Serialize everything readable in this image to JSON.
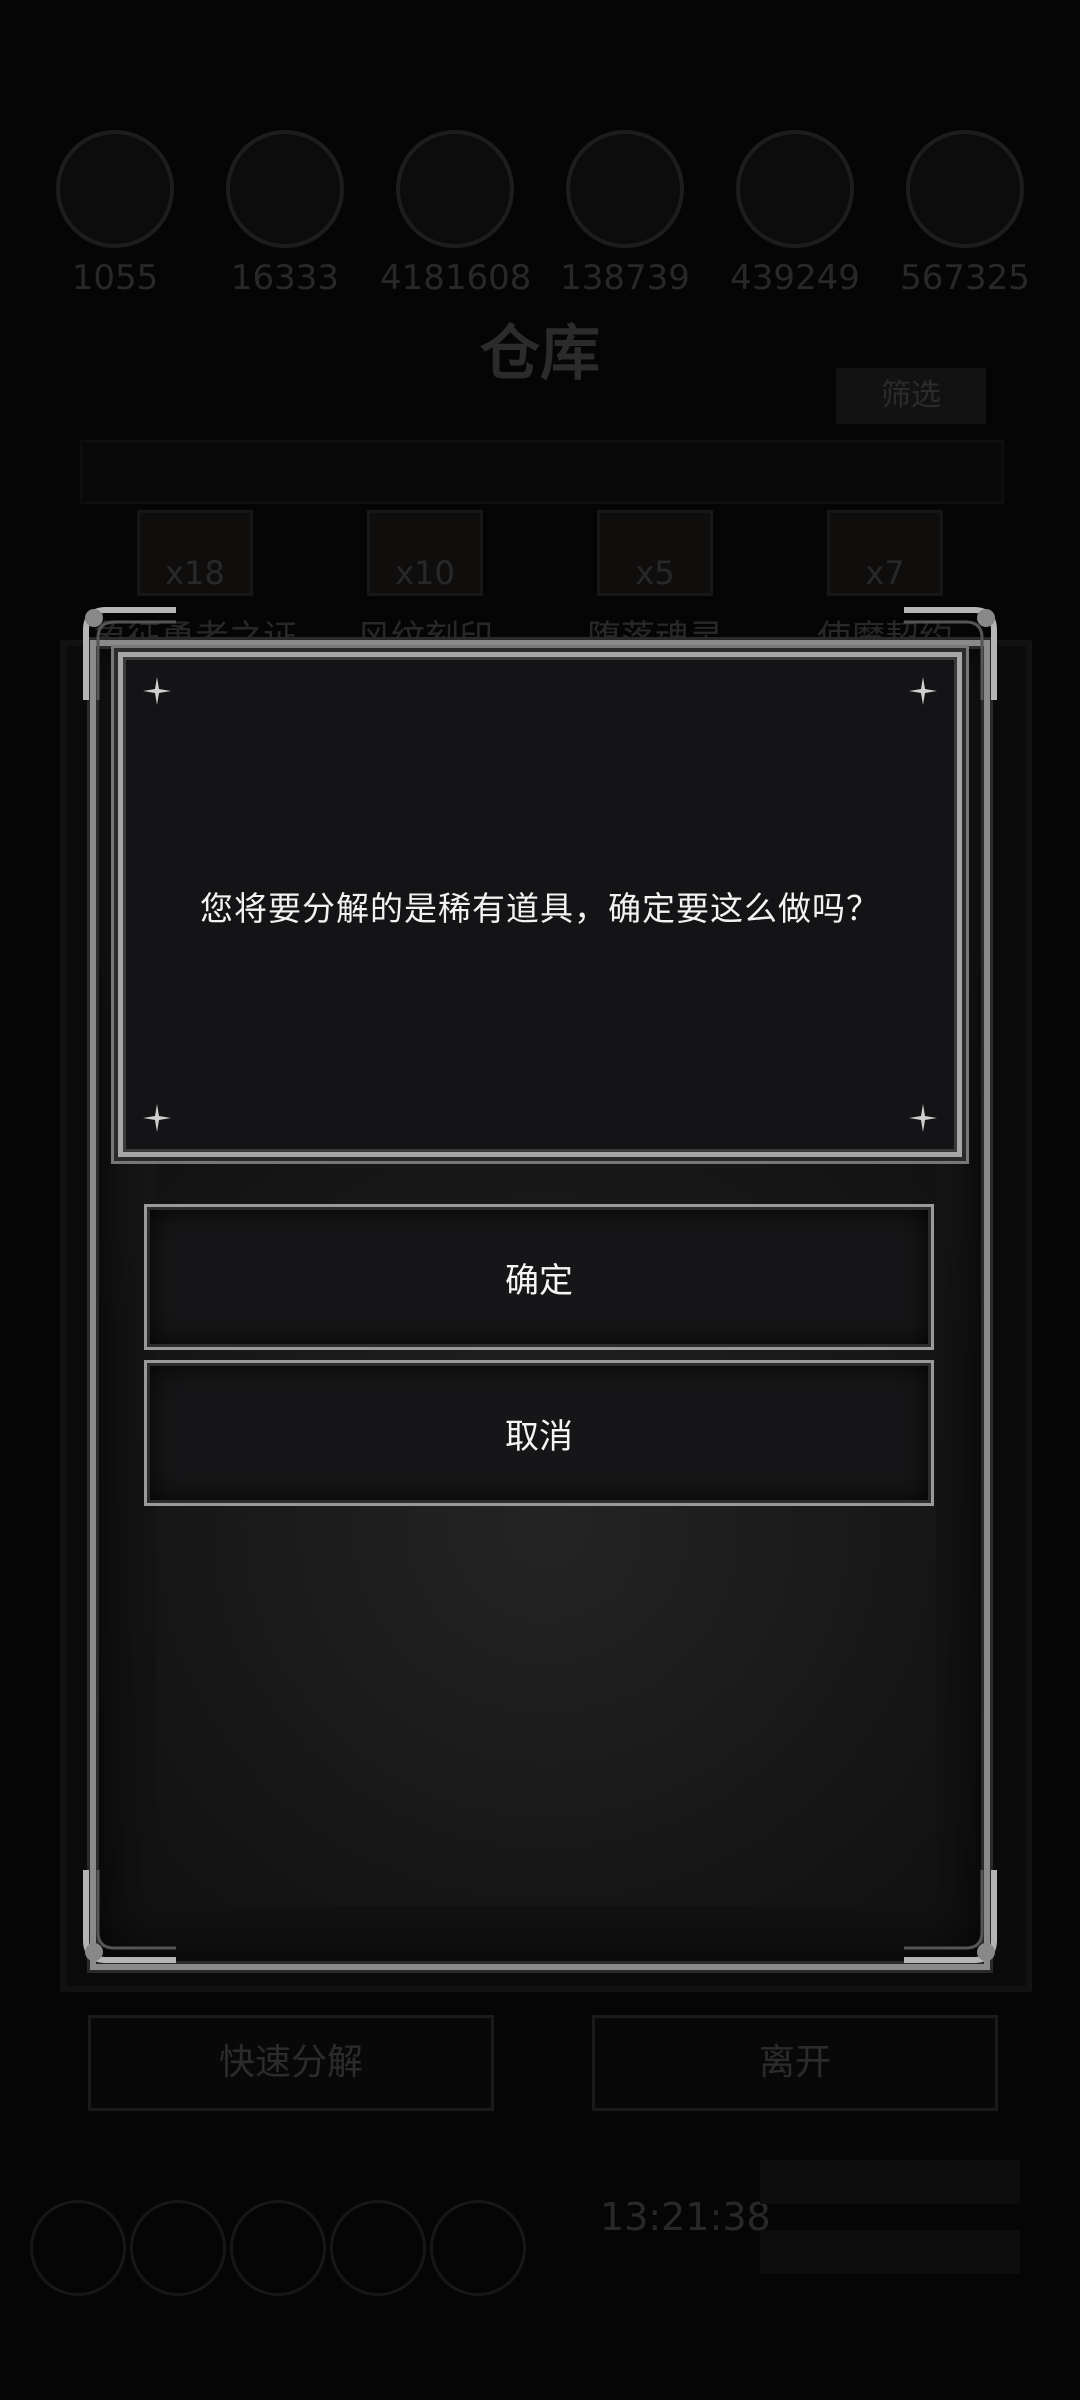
{
  "background": {
    "currencies": [
      "1055",
      "16333",
      "4181608",
      "138739",
      "439249",
      "567325"
    ],
    "title": "仓库",
    "filter_label": "筛选",
    "items": [
      {
        "count": "x18",
        "name": "象征勇者之证"
      },
      {
        "count": "x10",
        "name": "风纹刻印"
      },
      {
        "count": "x5",
        "name": "堕落魂灵"
      },
      {
        "count": "x7",
        "name": "使魔契约"
      }
    ],
    "quick_dismantle_label": "快速分解",
    "leave_label": "离开",
    "clock": "13:21:38"
  },
  "dialog": {
    "message": "您将要分解的是稀有道具，确定要这么做吗？",
    "confirm_label": "确定",
    "cancel_label": "取消"
  }
}
